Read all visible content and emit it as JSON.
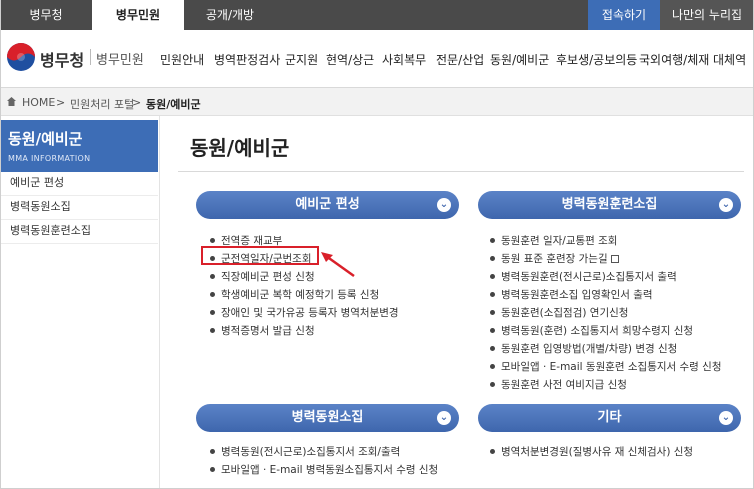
{
  "topbar": {
    "tabs": [
      "병무청",
      "병무민원",
      "공개/개방"
    ],
    "access_btn": "접속하기",
    "my_btn": "나만의 누리집"
  },
  "header": {
    "brand": "병무청",
    "brand_sub": "병무민원",
    "gnb": [
      "민원안내",
      "병역판정검사",
      "군지원",
      "현역/상근",
      "사회복무",
      "전문/산업",
      "동원/예비군",
      "후보생/공보의등",
      "국외여행/체재",
      "대체역"
    ]
  },
  "breadcrumb": {
    "home": "HOME",
    "sep": ">",
    "level1": "민원처리 포털",
    "current": "동원/예비군"
  },
  "sidebar": {
    "title": "동원/예비군",
    "subtitle": "MMA INFORMATION",
    "items": [
      "예비군 편성",
      "병력동원소집",
      "병력동원훈련소집"
    ]
  },
  "main": {
    "title": "동원/예비군",
    "sections": [
      {
        "title": "예비군 편성",
        "items": [
          "전역증 재교부",
          "군전역일자/군번조회",
          "직장예비군 편성 신청",
          "학생예비군 복학 예정학기 등록 신청",
          "장애인 및 국가유공 등록자 병역처분변경",
          "병적증명서 발급 신청"
        ]
      },
      {
        "title": "병력동원훈련소집",
        "items": [
          "동원훈련 일자/교통편 조회",
          "동원 표준 훈련장 가는길",
          "병력동원훈련(전시근로)소집통지서 출력",
          "병력동원훈련소집 입영확인서 출력",
          "동원훈련(소집점검) 연기신청",
          "병력동원(훈련) 소집통지서 희망수령지 신청",
          "동원훈련 입영방법(개별/차량) 변경 신청",
          "모바일앱 · E-mail 동원훈련 소집통지서 수령 신청",
          "동원훈련 사전 여비지급 신청"
        ]
      },
      {
        "title": "병력동원소집",
        "items": [
          "병력동원(전시근로)소집통지서 조회/출력",
          "모바일앱 · E-mail 병력동원소집통지서 수령 신청"
        ]
      },
      {
        "title": "기타",
        "items": [
          "병역처분변경원(질병사유 재 신체검사) 신청"
        ]
      }
    ],
    "chevron": "⌄",
    "highlight_color": "#d9202a"
  }
}
